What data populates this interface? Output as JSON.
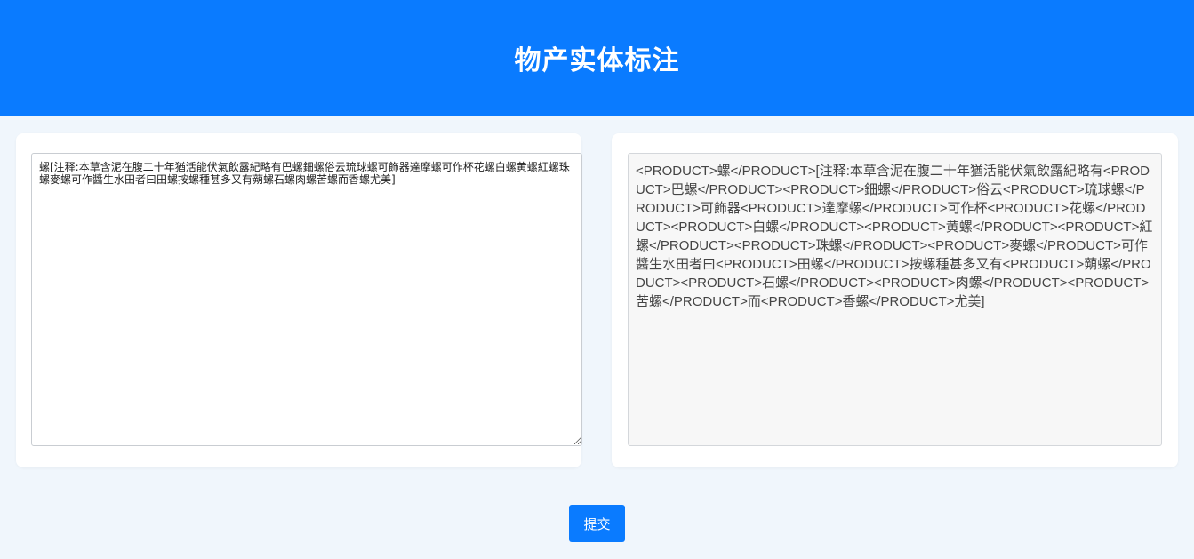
{
  "header": {
    "title": "物产实体标注"
  },
  "input": {
    "value": "螺[注释:本草含泥在腹二十年猶活能伏氣飲露紀略有巴螺鈿螺俗云琉球螺可飾器達摩螺可作杯花螺白螺黄螺紅螺珠螺麥螺可作醬生水田者曰田螺按螺種甚多又有蒴螺石螺肉螺苦螺而香螺尤美]"
  },
  "output": {
    "value": "<PRODUCT>螺</PRODUCT>[注释:本草含泥在腹二十年猶活能伏氣飲露紀略有<PRODUCT>巴螺</PRODUCT><PRODUCT>鈿螺</PRODUCT>俗云<PRODUCT>琉球螺</PRODUCT>可飾器<PRODUCT>達摩螺</PRODUCT>可作杯<PRODUCT>花螺</PRODUCT><PRODUCT>白螺</PRODUCT><PRODUCT>黄螺</PRODUCT><PRODUCT>紅螺</PRODUCT><PRODUCT>珠螺</PRODUCT><PRODUCT>麥螺</PRODUCT>可作醬生水田者曰<PRODUCT>田螺</PRODUCT>按螺種甚多又有<PRODUCT>蒴螺</PRODUCT><PRODUCT>石螺</PRODUCT><PRODUCT>肉螺</PRODUCT><PRODUCT>苦螺</PRODUCT>而<PRODUCT>香螺</PRODUCT>尤美]"
  },
  "actions": {
    "submit_label": "提交"
  },
  "colors": {
    "accent": "#0a7bff",
    "page_background": "#f0f6fc",
    "card_background": "#ffffff",
    "output_background": "#f7f7f7"
  }
}
